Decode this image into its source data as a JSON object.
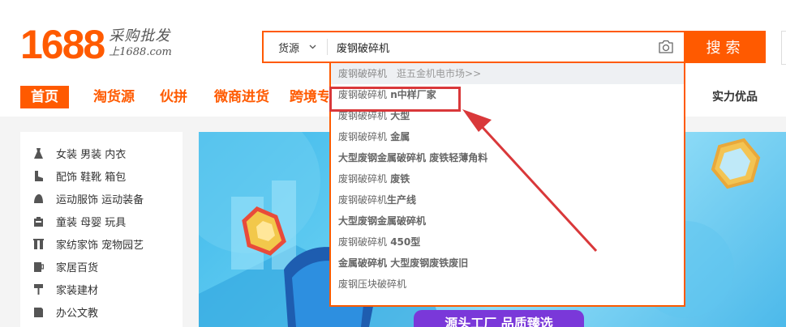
{
  "logo": {
    "number": "1688",
    "slogan": "采购批发",
    "url": "上1688.com"
  },
  "search": {
    "type_label": "货源",
    "value": "废钢破碎机",
    "button_label": "搜索"
  },
  "nav": {
    "items": [
      "首页",
      "淘货源",
      "伙拼",
      "微商进货",
      "跨境专"
    ],
    "right_label": "实力优品"
  },
  "sidebar": {
    "categories": [
      {
        "label": "女装 男装 内衣",
        "icon": "dress-icon"
      },
      {
        "label": "配饰 鞋靴 箱包",
        "icon": "boot-icon"
      },
      {
        "label": "运动服饰 运动装备",
        "icon": "helmet-icon"
      },
      {
        "label": "童装 母婴 玩具",
        "icon": "baby-icon"
      },
      {
        "label": "家纺家饰 宠物园艺",
        "icon": "curtain-icon"
      },
      {
        "label": "家居百货",
        "icon": "cup-icon"
      },
      {
        "label": "家装建材",
        "icon": "roller-icon"
      },
      {
        "label": "办公文教",
        "icon": "book-icon"
      }
    ]
  },
  "suggestions": {
    "items": [
      {
        "prefix": "废钢破碎机",
        "suffix": "",
        "more": "逛五金机电市场>>"
      },
      {
        "prefix": "废钢破碎机",
        "suffix": " n中样厂家"
      },
      {
        "prefix": "废钢破碎机",
        "suffix": " 大型"
      },
      {
        "prefix": "废钢破碎机",
        "suffix": " 金属"
      },
      {
        "prefix": "大型废钢金属破碎机",
        "suffix": " 废铁轻薄角料"
      },
      {
        "prefix": "废钢破碎机",
        "suffix": " 废铁"
      },
      {
        "prefix": "废钢破碎机",
        "suffix": "生产线"
      },
      {
        "prefix": "大型废钢金属破碎机",
        "suffix": ""
      },
      {
        "prefix": "废钢破碎机",
        "suffix": " 450型"
      },
      {
        "prefix": "金属破碎机",
        "suffix": " 大型废钢废铁废旧"
      },
      {
        "prefix": "废钢压块破碎机",
        "suffix": ""
      }
    ]
  },
  "banner": {
    "caption": "源头工厂 品质臻选"
  },
  "colors": {
    "brand": "#ff5a00",
    "annotation_red": "#d9383a",
    "banner_blue": "#4cb9ea",
    "banner_purple": "#7a38d9"
  }
}
